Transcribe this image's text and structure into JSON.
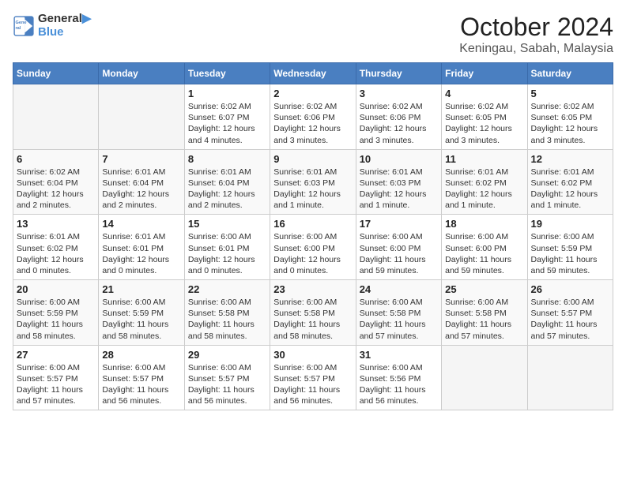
{
  "logo": {
    "line1": "General",
    "line2": "Blue"
  },
  "title": "October 2024",
  "location": "Keningau, Sabah, Malaysia",
  "days_of_week": [
    "Sunday",
    "Monday",
    "Tuesday",
    "Wednesday",
    "Thursday",
    "Friday",
    "Saturday"
  ],
  "weeks": [
    [
      {
        "day": "",
        "info": ""
      },
      {
        "day": "",
        "info": ""
      },
      {
        "day": "1",
        "info": "Sunrise: 6:02 AM\nSunset: 6:07 PM\nDaylight: 12 hours and 4 minutes."
      },
      {
        "day": "2",
        "info": "Sunrise: 6:02 AM\nSunset: 6:06 PM\nDaylight: 12 hours and 3 minutes."
      },
      {
        "day": "3",
        "info": "Sunrise: 6:02 AM\nSunset: 6:06 PM\nDaylight: 12 hours and 3 minutes."
      },
      {
        "day": "4",
        "info": "Sunrise: 6:02 AM\nSunset: 6:05 PM\nDaylight: 12 hours and 3 minutes."
      },
      {
        "day": "5",
        "info": "Sunrise: 6:02 AM\nSunset: 6:05 PM\nDaylight: 12 hours and 3 minutes."
      }
    ],
    [
      {
        "day": "6",
        "info": "Sunrise: 6:02 AM\nSunset: 6:04 PM\nDaylight: 12 hours and 2 minutes."
      },
      {
        "day": "7",
        "info": "Sunrise: 6:01 AM\nSunset: 6:04 PM\nDaylight: 12 hours and 2 minutes."
      },
      {
        "day": "8",
        "info": "Sunrise: 6:01 AM\nSunset: 6:04 PM\nDaylight: 12 hours and 2 minutes."
      },
      {
        "day": "9",
        "info": "Sunrise: 6:01 AM\nSunset: 6:03 PM\nDaylight: 12 hours and 1 minute."
      },
      {
        "day": "10",
        "info": "Sunrise: 6:01 AM\nSunset: 6:03 PM\nDaylight: 12 hours and 1 minute."
      },
      {
        "day": "11",
        "info": "Sunrise: 6:01 AM\nSunset: 6:02 PM\nDaylight: 12 hours and 1 minute."
      },
      {
        "day": "12",
        "info": "Sunrise: 6:01 AM\nSunset: 6:02 PM\nDaylight: 12 hours and 1 minute."
      }
    ],
    [
      {
        "day": "13",
        "info": "Sunrise: 6:01 AM\nSunset: 6:02 PM\nDaylight: 12 hours and 0 minutes."
      },
      {
        "day": "14",
        "info": "Sunrise: 6:01 AM\nSunset: 6:01 PM\nDaylight: 12 hours and 0 minutes."
      },
      {
        "day": "15",
        "info": "Sunrise: 6:00 AM\nSunset: 6:01 PM\nDaylight: 12 hours and 0 minutes."
      },
      {
        "day": "16",
        "info": "Sunrise: 6:00 AM\nSunset: 6:00 PM\nDaylight: 12 hours and 0 minutes."
      },
      {
        "day": "17",
        "info": "Sunrise: 6:00 AM\nSunset: 6:00 PM\nDaylight: 11 hours and 59 minutes."
      },
      {
        "day": "18",
        "info": "Sunrise: 6:00 AM\nSunset: 6:00 PM\nDaylight: 11 hours and 59 minutes."
      },
      {
        "day": "19",
        "info": "Sunrise: 6:00 AM\nSunset: 5:59 PM\nDaylight: 11 hours and 59 minutes."
      }
    ],
    [
      {
        "day": "20",
        "info": "Sunrise: 6:00 AM\nSunset: 5:59 PM\nDaylight: 11 hours and 58 minutes."
      },
      {
        "day": "21",
        "info": "Sunrise: 6:00 AM\nSunset: 5:59 PM\nDaylight: 11 hours and 58 minutes."
      },
      {
        "day": "22",
        "info": "Sunrise: 6:00 AM\nSunset: 5:58 PM\nDaylight: 11 hours and 58 minutes."
      },
      {
        "day": "23",
        "info": "Sunrise: 6:00 AM\nSunset: 5:58 PM\nDaylight: 11 hours and 58 minutes."
      },
      {
        "day": "24",
        "info": "Sunrise: 6:00 AM\nSunset: 5:58 PM\nDaylight: 11 hours and 57 minutes."
      },
      {
        "day": "25",
        "info": "Sunrise: 6:00 AM\nSunset: 5:58 PM\nDaylight: 11 hours and 57 minutes."
      },
      {
        "day": "26",
        "info": "Sunrise: 6:00 AM\nSunset: 5:57 PM\nDaylight: 11 hours and 57 minutes."
      }
    ],
    [
      {
        "day": "27",
        "info": "Sunrise: 6:00 AM\nSunset: 5:57 PM\nDaylight: 11 hours and 57 minutes."
      },
      {
        "day": "28",
        "info": "Sunrise: 6:00 AM\nSunset: 5:57 PM\nDaylight: 11 hours and 56 minutes."
      },
      {
        "day": "29",
        "info": "Sunrise: 6:00 AM\nSunset: 5:57 PM\nDaylight: 11 hours and 56 minutes."
      },
      {
        "day": "30",
        "info": "Sunrise: 6:00 AM\nSunset: 5:57 PM\nDaylight: 11 hours and 56 minutes."
      },
      {
        "day": "31",
        "info": "Sunrise: 6:00 AM\nSunset: 5:56 PM\nDaylight: 11 hours and 56 minutes."
      },
      {
        "day": "",
        "info": ""
      },
      {
        "day": "",
        "info": ""
      }
    ]
  ]
}
